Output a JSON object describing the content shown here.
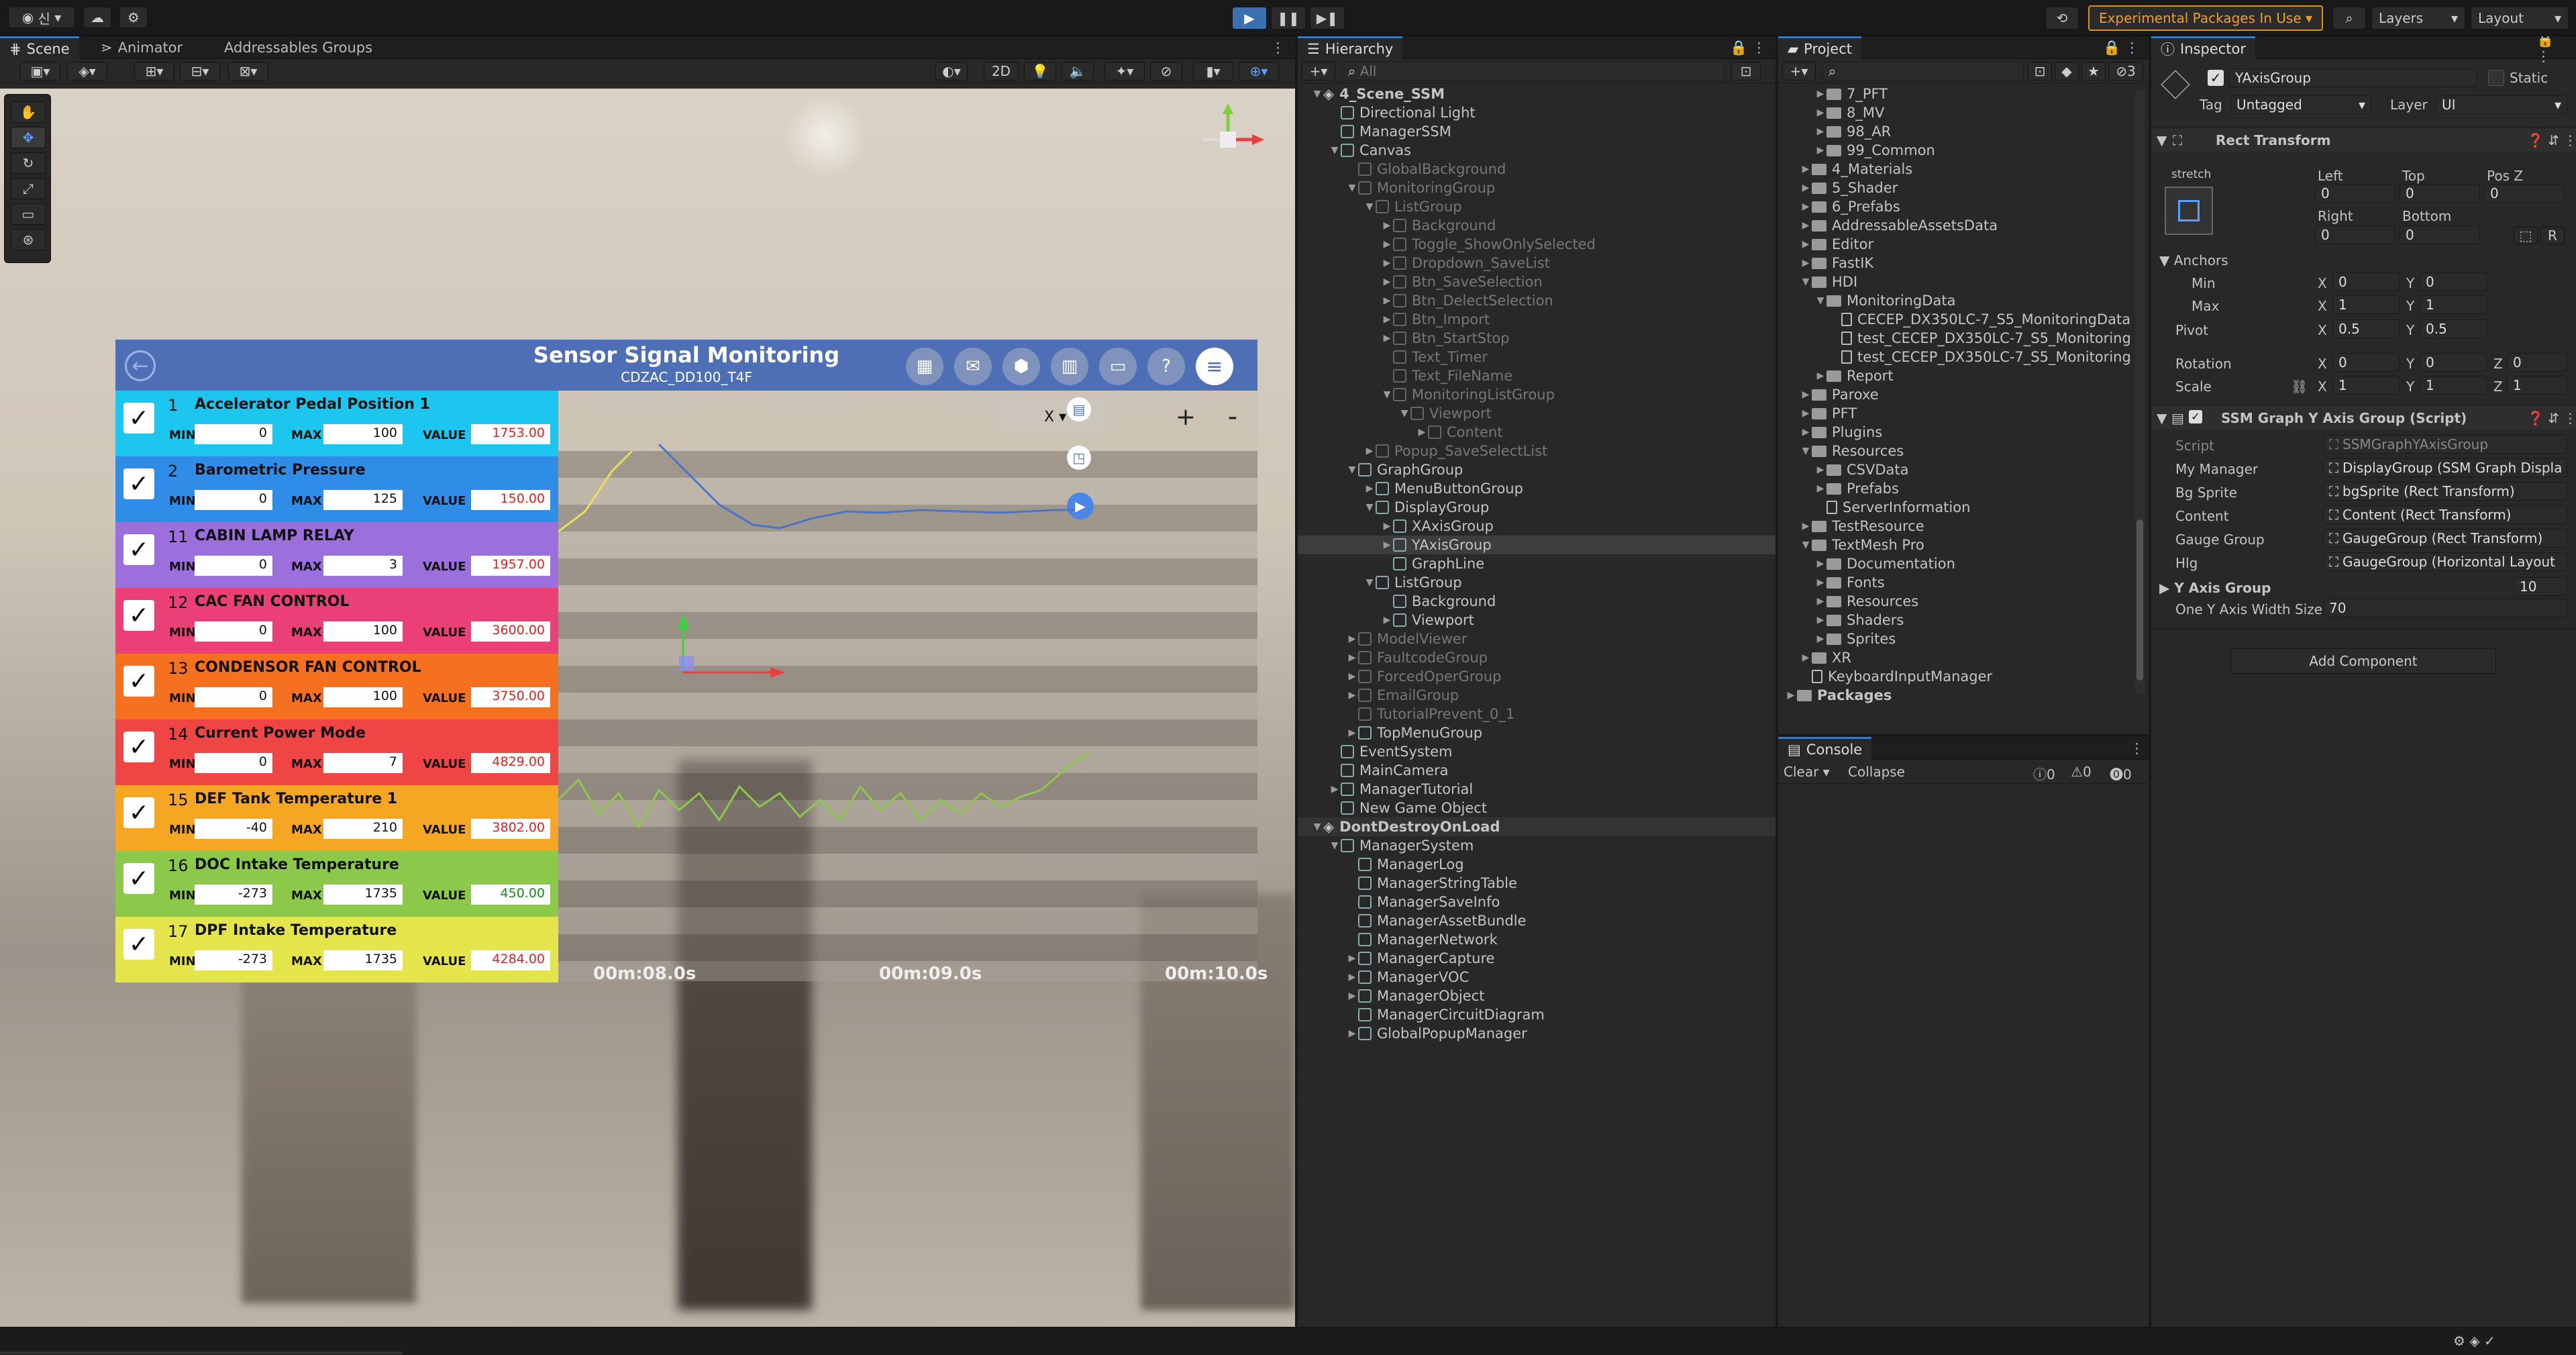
{
  "toolbar": {
    "account": "신",
    "experimental": "Experimental Packages In Use",
    "layers": "Layers",
    "layout": "Layout"
  },
  "scene_tabs": [
    "Scene",
    "Animator",
    "Addressables Groups"
  ],
  "scene_toolbar": {
    "mode2d": "2D"
  },
  "monitor": {
    "title": "Sensor Signal Monitoring",
    "subtitle": "CDZAC_DD100_T4F",
    "x_label": "X",
    "plus": "+",
    "minus": "-",
    "min_label": "MIN",
    "max_label": "MAX",
    "value_label": "VALUE",
    "signals": [
      {
        "num": "1",
        "name": "Accelerator Pedal Position 1",
        "min": "0",
        "max": "100",
        "value": "1753.00",
        "color": "#1cc6ee",
        "vcolor": "red"
      },
      {
        "num": "2",
        "name": "Barometric Pressure",
        "min": "0",
        "max": "125",
        "value": "150.00",
        "color": "#2f8de8",
        "vcolor": "red"
      },
      {
        "num": "11",
        "name": "CABIN LAMP RELAY",
        "min": "0",
        "max": "3",
        "value": "1957.00",
        "color": "#9b6fdc",
        "vcolor": "red"
      },
      {
        "num": "12",
        "name": "CAC FAN CONTROL",
        "min": "0",
        "max": "100",
        "value": "3600.00",
        "color": "#ea3f77",
        "vcolor": "red"
      },
      {
        "num": "13",
        "name": "CONDENSOR FAN CONTROL",
        "min": "0",
        "max": "100",
        "value": "3750.00",
        "color": "#f5701f",
        "vcolor": "red"
      },
      {
        "num": "14",
        "name": "Current Power Mode",
        "min": "0",
        "max": "7",
        "value": "4829.00",
        "color": "#f04545",
        "vcolor": "red"
      },
      {
        "num": "15",
        "name": "DEF Tank Temperature 1",
        "min": "-40",
        "max": "210",
        "value": "3802.00",
        "color": "#f5a623",
        "vcolor": "red"
      },
      {
        "num": "16",
        "name": "DOC Intake Temperature",
        "min": "-273",
        "max": "1735",
        "value": "450.00",
        "color": "#8cc94b",
        "vcolor": "green"
      },
      {
        "num": "17",
        "name": "DPF Intake Temperature",
        "min": "-273",
        "max": "1735",
        "value": "4284.00",
        "color": "#e4e54a",
        "vcolor": "red"
      }
    ],
    "times": [
      "00m:08.0s",
      "00m:09.0s",
      "00m:10.0s"
    ]
  },
  "hierarchy": {
    "title": "Hierarchy",
    "search": "All",
    "items": [
      {
        "t": "4_Scene_SSM",
        "d": 0,
        "a": "▼",
        "k": "scene",
        "dim": false
      },
      {
        "t": "Directional Light",
        "d": 1,
        "a": "",
        "k": "go",
        "dim": false
      },
      {
        "t": "ManagerSSM",
        "d": 1,
        "a": "",
        "k": "go",
        "dim": false
      },
      {
        "t": "Canvas",
        "d": 1,
        "a": "▼",
        "k": "go",
        "dim": false
      },
      {
        "t": "GlobalBackground",
        "d": 2,
        "a": "",
        "k": "go",
        "dim": true
      },
      {
        "t": "MonitoringGroup",
        "d": 2,
        "a": "▼",
        "k": "go",
        "dim": true
      },
      {
        "t": "ListGroup",
        "d": 3,
        "a": "▼",
        "k": "go",
        "dim": true
      },
      {
        "t": "Background",
        "d": 4,
        "a": "▶",
        "k": "go",
        "dim": true
      },
      {
        "t": "Toggle_ShowOnlySelected",
        "d": 4,
        "a": "▶",
        "k": "go",
        "dim": true
      },
      {
        "t": "Dropdown_SaveList",
        "d": 4,
        "a": "▶",
        "k": "go",
        "dim": true
      },
      {
        "t": "Btn_SaveSelection",
        "d": 4,
        "a": "▶",
        "k": "go",
        "dim": true
      },
      {
        "t": "Btn_DelectSelection",
        "d": 4,
        "a": "▶",
        "k": "go",
        "dim": true
      },
      {
        "t": "Btn_Import",
        "d": 4,
        "a": "▶",
        "k": "go",
        "dim": true
      },
      {
        "t": "Btn_StartStop",
        "d": 4,
        "a": "▶",
        "k": "go",
        "dim": true
      },
      {
        "t": "Text_Timer",
        "d": 4,
        "a": "",
        "k": "go",
        "dim": true
      },
      {
        "t": "Text_FileName",
        "d": 4,
        "a": "",
        "k": "go",
        "dim": true
      },
      {
        "t": "MonitoringListGroup",
        "d": 4,
        "a": "▼",
        "k": "go",
        "dim": true
      },
      {
        "t": "Viewport",
        "d": 5,
        "a": "▼",
        "k": "go",
        "dim": true
      },
      {
        "t": "Content",
        "d": 6,
        "a": "▶",
        "k": "go",
        "dim": true
      },
      {
        "t": "Popup_SaveSelectList",
        "d": 3,
        "a": "▶",
        "k": "go",
        "dim": true
      },
      {
        "t": "GraphGroup",
        "d": 2,
        "a": "▼",
        "k": "go",
        "dim": false
      },
      {
        "t": "MenuButtonGroup",
        "d": 3,
        "a": "▶",
        "k": "go",
        "dim": false
      },
      {
        "t": "DisplayGroup",
        "d": 3,
        "a": "▼",
        "k": "go",
        "dim": false
      },
      {
        "t": "XAxisGroup",
        "d": 4,
        "a": "▶",
        "k": "go",
        "dim": false
      },
      {
        "t": "YAxisGroup",
        "d": 4,
        "a": "▶",
        "k": "go",
        "dim": false,
        "sel": true
      },
      {
        "t": "GraphLine",
        "d": 4,
        "a": "",
        "k": "go",
        "dim": false
      },
      {
        "t": "ListGroup",
        "d": 3,
        "a": "▼",
        "k": "go",
        "dim": false
      },
      {
        "t": "Background",
        "d": 4,
        "a": "",
        "k": "go",
        "dim": false
      },
      {
        "t": "Viewport",
        "d": 4,
        "a": "▶",
        "k": "go",
        "dim": false
      },
      {
        "t": "ModelViewer",
        "d": 2,
        "a": "▶",
        "k": "go",
        "dim": true
      },
      {
        "t": "FaultcodeGroup",
        "d": 2,
        "a": "▶",
        "k": "go",
        "dim": true
      },
      {
        "t": "ForcedOperGroup",
        "d": 2,
        "a": "▶",
        "k": "go",
        "dim": true
      },
      {
        "t": "EmailGroup",
        "d": 2,
        "a": "▶",
        "k": "go",
        "dim": true
      },
      {
        "t": "TutorialPrevent_0_1",
        "d": 2,
        "a": "",
        "k": "go",
        "dim": true
      },
      {
        "t": "TopMenuGroup",
        "d": 2,
        "a": "▶",
        "k": "go",
        "dim": false
      },
      {
        "t": "EventSystem",
        "d": 1,
        "a": "",
        "k": "go",
        "dim": false
      },
      {
        "t": "MainCamera",
        "d": 1,
        "a": "",
        "k": "go",
        "dim": false
      },
      {
        "t": "ManagerTutorial",
        "d": 1,
        "a": "▶",
        "k": "go",
        "dim": false
      },
      {
        "t": "New Game Object",
        "d": 1,
        "a": "",
        "k": "go",
        "dim": false
      },
      {
        "t": "DontDestroyOnLoad",
        "d": 0,
        "a": "▼",
        "k": "scene",
        "dim": false,
        "hdr": true
      },
      {
        "t": "ManagerSystem",
        "d": 1,
        "a": "▼",
        "k": "go",
        "dim": false
      },
      {
        "t": "ManagerLog",
        "d": 2,
        "a": "",
        "k": "go",
        "dim": false
      },
      {
        "t": "ManagerStringTable",
        "d": 2,
        "a": "",
        "k": "go",
        "dim": false
      },
      {
        "t": "ManagerSaveInfo",
        "d": 2,
        "a": "",
        "k": "go",
        "dim": false
      },
      {
        "t": "ManagerAssetBundle",
        "d": 2,
        "a": "",
        "k": "go",
        "dim": false
      },
      {
        "t": "ManagerNetwork",
        "d": 2,
        "a": "",
        "k": "go",
        "dim": false
      },
      {
        "t": "ManagerCapture",
        "d": 2,
        "a": "▶",
        "k": "go",
        "dim": false
      },
      {
        "t": "ManagerVOC",
        "d": 2,
        "a": "▶",
        "k": "go",
        "dim": false
      },
      {
        "t": "ManagerObject",
        "d": 2,
        "a": "▶",
        "k": "go",
        "dim": false
      },
      {
        "t": "ManagerCircuitDiagram",
        "d": 2,
        "a": "",
        "k": "go",
        "dim": false
      },
      {
        "t": "GlobalPopupManager",
        "d": 2,
        "a": "▶",
        "k": "go",
        "dim": false
      }
    ]
  },
  "project": {
    "title": "Project",
    "items": [
      {
        "t": "7_PFT",
        "d": 2,
        "a": "▶",
        "k": "folder"
      },
      {
        "t": "8_MV",
        "d": 2,
        "a": "▶",
        "k": "folder"
      },
      {
        "t": "98_AR",
        "d": 2,
        "a": "▶",
        "k": "folder"
      },
      {
        "t": "99_Common",
        "d": 2,
        "a": "▶",
        "k": "folder"
      },
      {
        "t": "4_Materials",
        "d": 1,
        "a": "▶",
        "k": "folder"
      },
      {
        "t": "5_Shader",
        "d": 1,
        "a": "▶",
        "k": "folder"
      },
      {
        "t": "6_Prefabs",
        "d": 1,
        "a": "▶",
        "k": "folder"
      },
      {
        "t": "AddressableAssetsData",
        "d": 1,
        "a": "▶",
        "k": "folder"
      },
      {
        "t": "Editor",
        "d": 1,
        "a": "▶",
        "k": "folder"
      },
      {
        "t": "FastIK",
        "d": 1,
        "a": "▶",
        "k": "folder"
      },
      {
        "t": "HDI",
        "d": 1,
        "a": "▼",
        "k": "folder"
      },
      {
        "t": "MonitoringData",
        "d": 2,
        "a": "▼",
        "k": "folder"
      },
      {
        "t": "CECEP_DX350LC-7_S5_MonitoringData",
        "d": 3,
        "a": "",
        "k": "file"
      },
      {
        "t": "test_CECEP_DX350LC-7_S5_Monitoring",
        "d": 3,
        "a": "",
        "k": "file"
      },
      {
        "t": "test_CECEP_DX350LC-7_S5_Monitoring",
        "d": 3,
        "a": "",
        "k": "file"
      },
      {
        "t": "Report",
        "d": 2,
        "a": "▶",
        "k": "folder"
      },
      {
        "t": "Paroxe",
        "d": 1,
        "a": "▶",
        "k": "folder"
      },
      {
        "t": "PFT",
        "d": 1,
        "a": "▶",
        "k": "folder"
      },
      {
        "t": "Plugins",
        "d": 1,
        "a": "▶",
        "k": "folder"
      },
      {
        "t": "Resources",
        "d": 1,
        "a": "▼",
        "k": "folder"
      },
      {
        "t": "CSVData",
        "d": 2,
        "a": "▶",
        "k": "folder"
      },
      {
        "t": "Prefabs",
        "d": 2,
        "a": "▶",
        "k": "folder"
      },
      {
        "t": "ServerInformation",
        "d": 2,
        "a": "",
        "k": "file"
      },
      {
        "t": "TestResource",
        "d": 1,
        "a": "▶",
        "k": "folder"
      },
      {
        "t": "TextMesh Pro",
        "d": 1,
        "a": "▼",
        "k": "folder"
      },
      {
        "t": "Documentation",
        "d": 2,
        "a": "▶",
        "k": "folder"
      },
      {
        "t": "Fonts",
        "d": 2,
        "a": "▶",
        "k": "folder"
      },
      {
        "t": "Resources",
        "d": 2,
        "a": "▶",
        "k": "folder"
      },
      {
        "t": "Shaders",
        "d": 2,
        "a": "▶",
        "k": "folder"
      },
      {
        "t": "Sprites",
        "d": 2,
        "a": "▶",
        "k": "folder"
      },
      {
        "t": "XR",
        "d": 1,
        "a": "▶",
        "k": "folder"
      },
      {
        "t": "KeyboardInputManager",
        "d": 1,
        "a": "",
        "k": "file"
      },
      {
        "t": "Packages",
        "d": 0,
        "a": "▶",
        "k": "folder",
        "bold": true
      }
    ]
  },
  "console": {
    "title": "Console",
    "clear": "Clear",
    "collapse": "Collapse",
    "counts": [
      "0",
      "0",
      "0"
    ]
  },
  "inspector": {
    "title": "Inspector",
    "object_name": "YAxisGroup",
    "static": "Static",
    "tag_label": "Tag",
    "tag_value": "Untagged",
    "layer_label": "Layer",
    "layer_value": "UI",
    "rect": {
      "title": "Rect Transform",
      "stretch": "stretch",
      "left": "Left",
      "top": "Top",
      "posz": "Pos Z",
      "left_v": "0",
      "top_v": "0",
      "posz_v": "0",
      "right": "Right",
      "bottom": "Bottom",
      "right_v": "0",
      "bottom_v": "0",
      "anchors": "Anchors",
      "min": "Min",
      "max": "Max",
      "minx": "0",
      "miny": "0",
      "maxx": "1",
      "maxy": "1",
      "pivot": "Pivot",
      "pivx": "0.5",
      "pivy": "0.5",
      "rotation": "Rotation",
      "rx": "0",
      "ry": "0",
      "rz": "0",
      "scale": "Scale",
      "sx": "1",
      "sy": "1",
      "sz": "1"
    },
    "script": {
      "title": "SSM Graph Y Axis Group (Script)",
      "rows": [
        {
          "k": "Script",
          "v": "SSMGraphYAxisGroup"
        },
        {
          "k": "My Manager",
          "v": "DisplayGroup (SSM Graph Displa"
        },
        {
          "k": "Bg Sprite",
          "v": "bgSprite (Rect Transform)"
        },
        {
          "k": "Content",
          "v": "Content (Rect Transform)"
        },
        {
          "k": "Gauge Group",
          "v": "GaugeGroup (Rect Transform)"
        },
        {
          "k": "Hlg",
          "v": "GaugeGroup (Horizontal Layout"
        }
      ],
      "yaxis_label": "Y Axis Group",
      "yaxis_value": "10",
      "width_label": "One Y Axis Width Size",
      "width_value": "70"
    },
    "add_component": "Add Component"
  }
}
